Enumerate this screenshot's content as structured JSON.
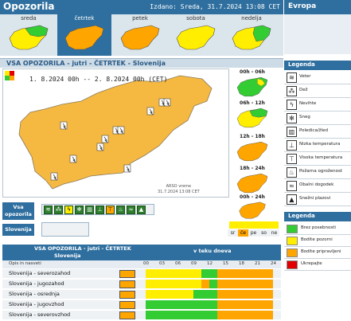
{
  "header": {
    "title": "Opozorila",
    "issued": "Izdano: Sreda, 31.7.2024 13:08 CET",
    "europe_tab": "Evropa"
  },
  "days": [
    {
      "label": "sreda",
      "selected": false
    },
    {
      "label": "četrtek",
      "selected": true
    },
    {
      "label": "petek",
      "selected": false
    },
    {
      "label": "sobota",
      "selected": false
    },
    {
      "label": "nedelja",
      "selected": false
    }
  ],
  "main_title": "VSA OPOZORILA   -   jutri   -   ČETRTEK   -   Slovenija",
  "map": {
    "date_range": "1. 8.2024 00h  --  2. 8.2024 00h    (CET)",
    "credit_line1": "ARSO vreme",
    "credit_line2": "31.7.2024  13:08 CET"
  },
  "time_maps": [
    {
      "label": "00h - 06h"
    },
    {
      "label": "06h - 12h"
    },
    {
      "label": "12h - 18h"
    },
    {
      "label": "18h - 24h"
    },
    {
      "label": "00h - 24h"
    }
  ],
  "filters": {
    "vsa_label": "Vsa opozorila",
    "slovenija_label": "Slovenija",
    "level_tags": [
      "sr",
      "če",
      "pe",
      "so",
      "ne"
    ]
  },
  "legend": {
    "title": "Legenda",
    "items": [
      {
        "icon": "wind-icon",
        "label": "Veter"
      },
      {
        "icon": "rain-icon",
        "label": "Dež"
      },
      {
        "icon": "thunderstorm-icon",
        "label": "Nevihte"
      },
      {
        "icon": "snow-icon",
        "label": "Sneg"
      },
      {
        "icon": "ice-icon",
        "label": "Poledica/žled"
      },
      {
        "icon": "low-temperature-icon",
        "label": "Nizka temperatura"
      },
      {
        "icon": "high-temperature-icon",
        "label": "Visoka temperatura"
      },
      {
        "icon": "fire-icon",
        "label": "Požarna ogroženost"
      },
      {
        "icon": "coastal-icon",
        "label": "Obalni dogodek"
      },
      {
        "icon": "avalanche-icon",
        "label": "Snežni plazovi"
      }
    ],
    "levels_title": "Legenda",
    "levels": [
      {
        "label": "Brez posebnosti",
        "color": "#33cc33"
      },
      {
        "label": "Bodite pozorni",
        "color": "#ffee00"
      },
      {
        "label": "Bodite pripravljeni",
        "color": "#ffa500"
      },
      {
        "label": "Ukrepajte",
        "color": "#e00000"
      }
    ]
  },
  "table": {
    "title": "VSA OPOZORILA - jutri - ČETRTEK",
    "subtitle": "Slovenija",
    "time_header": "v teku dneva",
    "col_label": "Opis in nasveti",
    "hours": [
      "00",
      "03",
      "06",
      "09",
      "12",
      "15",
      "18",
      "21",
      "24"
    ],
    "rows": [
      {
        "name": "Slovenija - severozahod"
      },
      {
        "name": "Slovenija - jugozahod"
      },
      {
        "name": "Slovenija - osrednja"
      },
      {
        "name": "Slovenija - jugovzhod"
      },
      {
        "name": "Slovenija - severovzhod"
      }
    ]
  },
  "colors": {
    "header_blue": "#2f6f9f",
    "green": "#33cc33",
    "yellow": "#ffee00",
    "orange": "#ffa500",
    "map_orange": "#f5b942"
  }
}
